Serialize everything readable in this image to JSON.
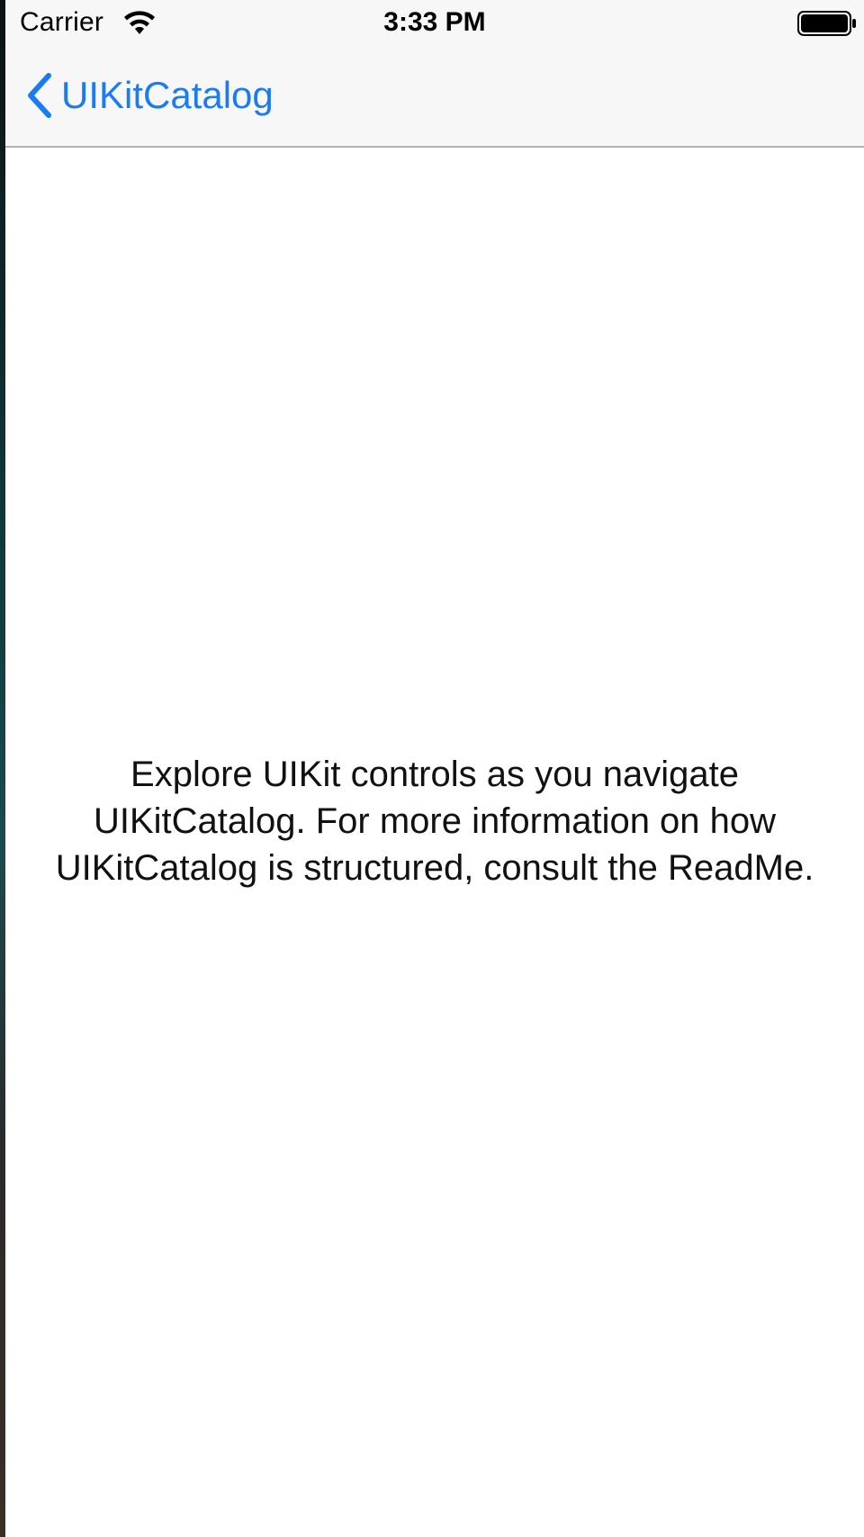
{
  "status_bar": {
    "carrier": "Carrier",
    "time": "3:33 PM",
    "wifi_icon": "wifi-icon",
    "battery_icon": "battery-full-icon"
  },
  "nav_bar": {
    "back_label": "UIKitCatalog",
    "back_icon": "chevron-left-icon",
    "tint_color": "#1a7cf2"
  },
  "content": {
    "text": "Explore UIKit controls as you navigate UIKitCatalog. For more information on how UIKitCatalog is structured, consult the ReadMe."
  }
}
